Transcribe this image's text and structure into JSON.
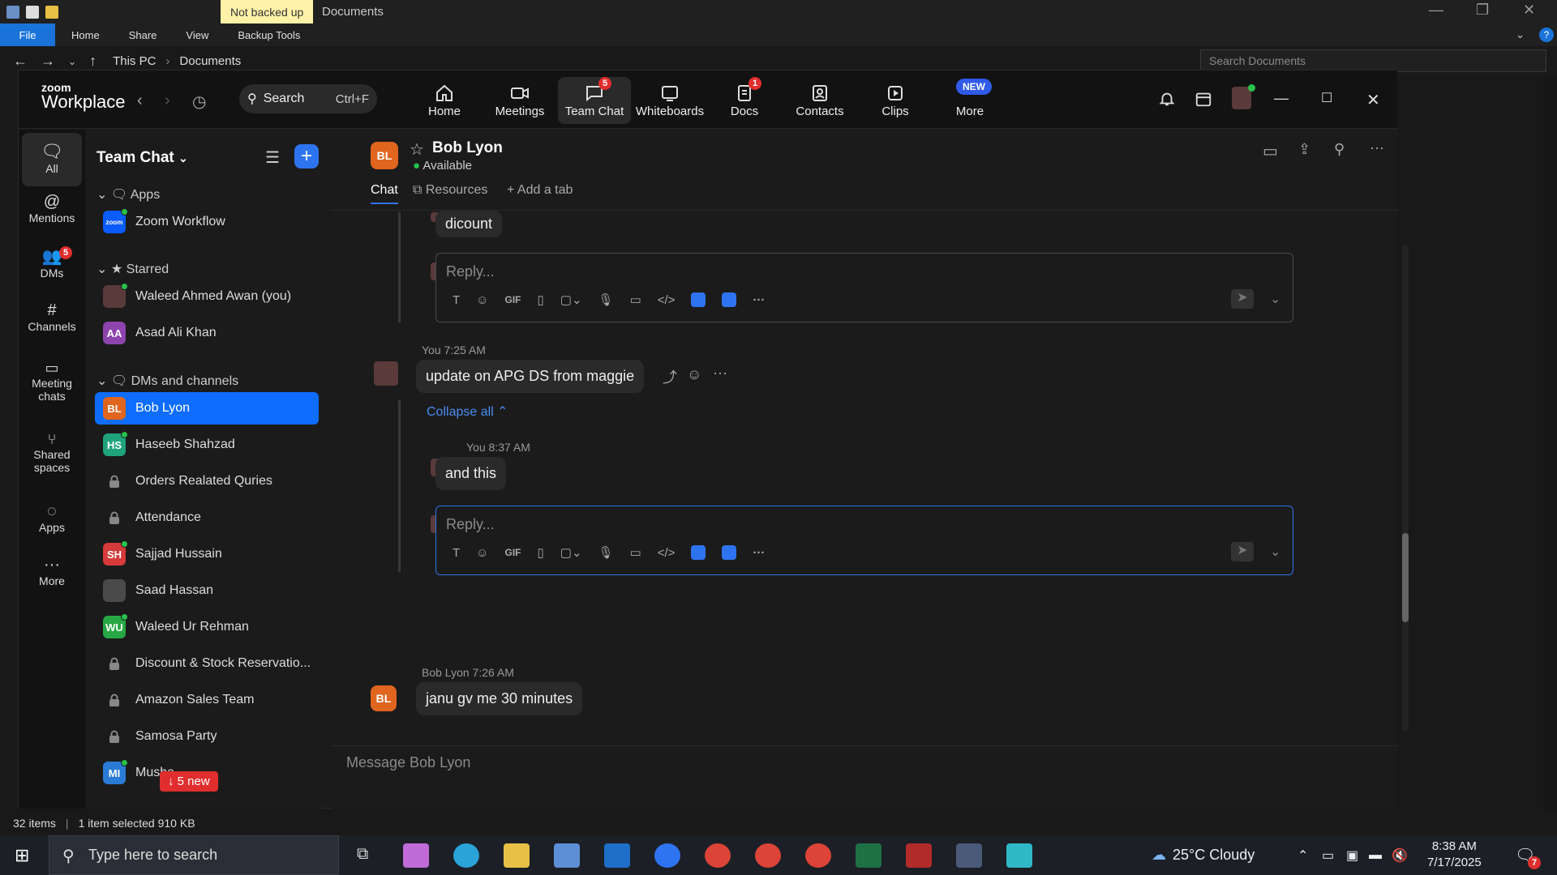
{
  "explorer": {
    "backup_label": "Not backed up",
    "window_title": "Documents",
    "ribbon": {
      "file": "File",
      "home": "Home",
      "share": "Share",
      "view": "View",
      "tools": "Backup Tools"
    },
    "address": {
      "this_pc": "This PC",
      "documents": "Documents"
    },
    "search_placeholder": "Search Documents",
    "status": {
      "items": "32 items",
      "selected": "1 item selected 910 KB"
    }
  },
  "zoom": {
    "logo_top": "zoom",
    "logo_bottom": "Workplace",
    "search_label": "Search",
    "search_shortcut": "Ctrl+F",
    "nav": [
      {
        "label": "Home",
        "icon": "home-icon"
      },
      {
        "label": "Meetings",
        "icon": "video-icon"
      },
      {
        "label": "Team Chat",
        "icon": "chat-icon",
        "badge": "5"
      },
      {
        "label": "Whiteboards",
        "icon": "whiteboard-icon"
      },
      {
        "label": "Docs",
        "icon": "docs-icon",
        "badge": "1"
      },
      {
        "label": "Contacts",
        "icon": "contacts-icon"
      },
      {
        "label": "Clips",
        "icon": "clips-icon"
      },
      {
        "label": "More",
        "icon": "more-icon",
        "badge": "NEW"
      }
    ],
    "rail": [
      {
        "label": "All",
        "icon": "chat-bubble-icon"
      },
      {
        "label": "Mentions",
        "icon": "at-icon"
      },
      {
        "label": "DMs",
        "icon": "people-icon",
        "badge": "5"
      },
      {
        "label": "Channels",
        "icon": "hash-icon"
      },
      {
        "label": "Meeting chats",
        "icon": "calendar-icon"
      },
      {
        "label": "Shared spaces",
        "icon": "share-icon"
      },
      {
        "label": "Apps",
        "icon": "apps-icon"
      },
      {
        "label": "More",
        "icon": "more-dots-icon"
      }
    ],
    "list": {
      "title": "Team Chat",
      "sections": {
        "apps": "Apps",
        "starred": "Starred",
        "dms": "DMs and channels"
      },
      "apps": [
        {
          "label": "Zoom Workflow",
          "initials": "zoom",
          "color": "#0b5cff"
        }
      ],
      "starred": [
        {
          "label": "Waleed Ahmed Awan (you)",
          "initials": "",
          "color": "#5a3a3a"
        },
        {
          "label": "Asad Ali Khan",
          "initials": "AA",
          "color": "#8e44ad"
        }
      ],
      "channels": [
        {
          "label": "Bob Lyon",
          "initials": "BL",
          "color": "#e0651f",
          "selected": true
        },
        {
          "label": "Haseeb Shahzad",
          "initials": "HS",
          "color": "#1fa37a"
        },
        {
          "label": "Orders Realated Quries",
          "lock": true
        },
        {
          "label": "Attendance",
          "lock": true
        },
        {
          "label": "Sajjad Hussain",
          "initials": "SH",
          "color": "#d63a3a"
        },
        {
          "label": "Saad Hassan",
          "initials": "",
          "color": "#4a4a4a"
        },
        {
          "label": "Waleed Ur Rehman",
          "initials": "WU",
          "color": "#27a844"
        },
        {
          "label": "Discount & Stock Reservatio...",
          "lock": true
        },
        {
          "label": "Amazon Sales Team",
          "lock": true
        },
        {
          "label": "Samosa Party",
          "lock": true
        },
        {
          "label": "Musha",
          "initials": "MI",
          "color": "#2a7bd6"
        }
      ],
      "new_pill": "5 new"
    },
    "chat": {
      "contact_initials": "BL",
      "contact_name": "Bob Lyon",
      "status": "Available",
      "tabs": {
        "chat": "Chat",
        "resources": "Resources",
        "add": "Add a tab"
      },
      "msg_discount": "dicount",
      "reply_placeholder": "Reply...",
      "msg2_meta": "You 7:25 AM",
      "msg2_text": "update on APG DS from maggie",
      "collapse": "Collapse all",
      "msg3_meta": "You 8:37 AM",
      "msg3_text": "and this",
      "msg4_meta": "Bob Lyon 7:26 AM",
      "msg4_text": "janu gv me 30 minutes",
      "compose_placeholder": "Message Bob Lyon",
      "tool_gif": "GIF"
    }
  },
  "taskbar": {
    "search_placeholder": "Type here to search",
    "weather": "25°C Cloudy",
    "time": "8:38 AM",
    "date": "7/17/2025",
    "notif_badge": "7"
  }
}
